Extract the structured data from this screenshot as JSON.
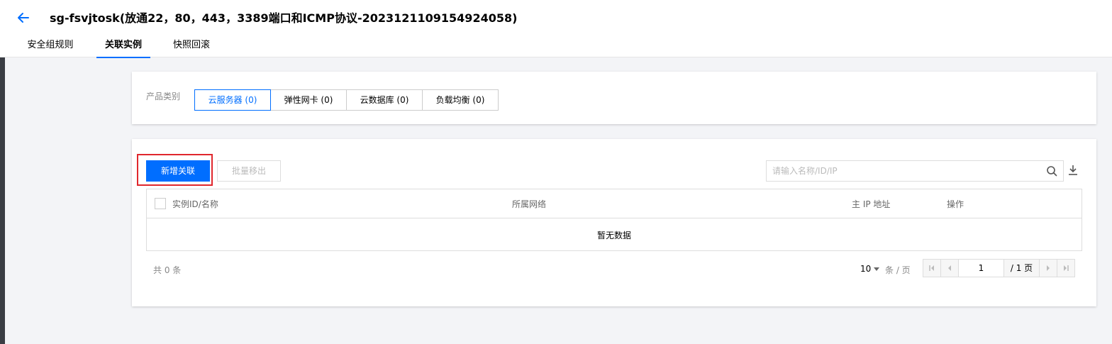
{
  "header": {
    "title": "sg-fsvjtosk(放通22，80，443，3389端口和ICMP协议-20231211091549240​58)",
    "tabs": [
      {
        "label": "安全组规则"
      },
      {
        "label": "关联实例"
      },
      {
        "label": "快照回滚"
      }
    ]
  },
  "filter": {
    "label": "产品类别",
    "options": [
      {
        "label": "云服务器 (0)"
      },
      {
        "label": "弹性网卡 (0)"
      },
      {
        "label": "云数据库 (0)"
      },
      {
        "label": "负载均衡 (0)"
      }
    ]
  },
  "toolbar": {
    "add_label": "新增关联",
    "batch_remove_label": "批量移出",
    "search_placeholder": "请输入名称/ID/IP"
  },
  "table": {
    "columns": [
      "实例ID/名称",
      "所属网络",
      "主 IP 地址",
      "操作"
    ],
    "empty_text": "暂无数据"
  },
  "pagination": {
    "total_text": "共 0 条",
    "page_size": "10",
    "per_page_label": "条 / 页",
    "current_page": "1",
    "total_pages": "/ 1 页"
  },
  "colors": {
    "accent": "#006eff",
    "highlight": "#e0272d"
  }
}
